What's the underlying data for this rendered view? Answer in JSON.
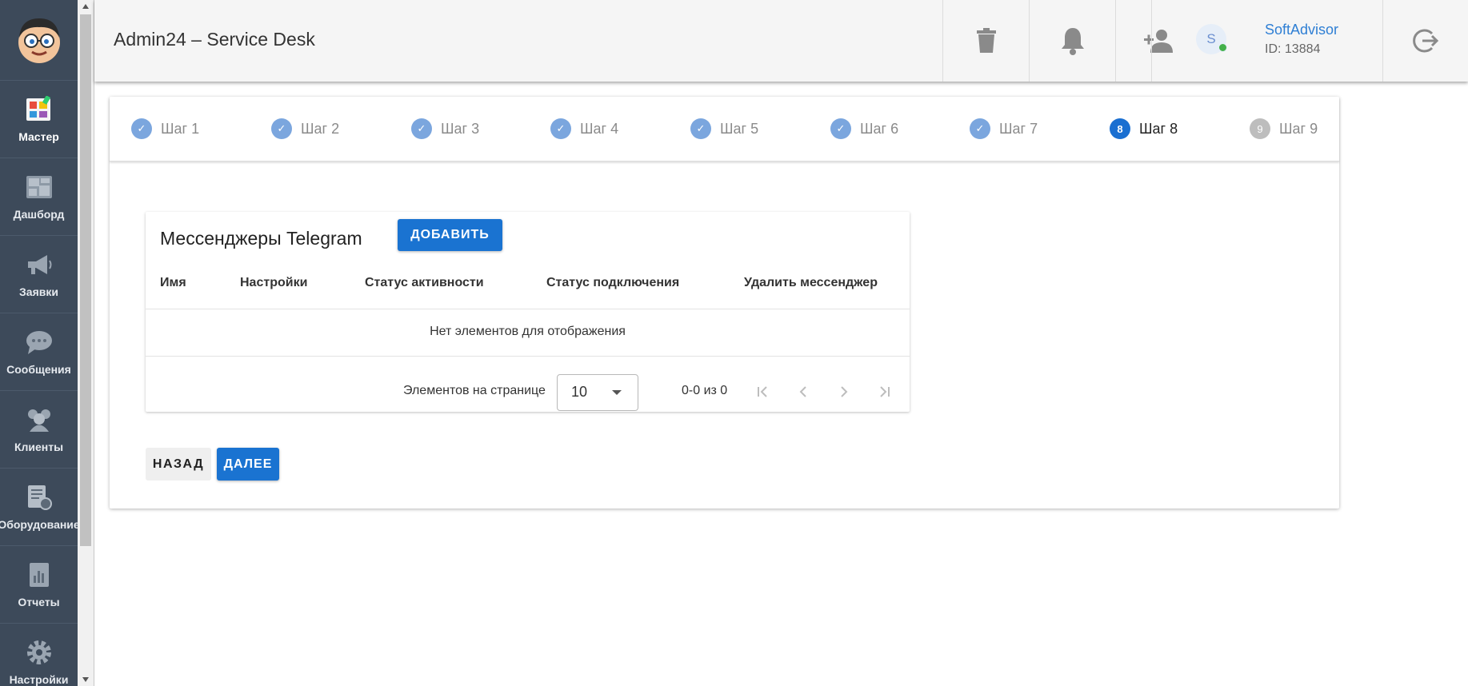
{
  "sidebar": {
    "items": [
      {
        "label": "Мастер",
        "icon": "wizard-icon",
        "active": true
      },
      {
        "label": "Дашборд",
        "icon": "dashboard-icon"
      },
      {
        "label": "Заявки",
        "icon": "megaphone-icon"
      },
      {
        "label": "Сообщения",
        "icon": "chat-icon"
      },
      {
        "label": "Клиенты",
        "icon": "clients-icon"
      },
      {
        "label": "Оборудование",
        "icon": "equipment-icon"
      },
      {
        "label": "Отчеты",
        "icon": "reports-icon"
      },
      {
        "label": "Настройки",
        "icon": "gear-icon"
      }
    ]
  },
  "header": {
    "title": "Admin24 – Service Desk",
    "user": {
      "avatar_letter": "S",
      "name": "SoftAdvisor",
      "id": "ID: 13884"
    },
    "icons": [
      "trash-icon",
      "bell-icon",
      "add-user-icon",
      "logout-icon"
    ]
  },
  "stepper": {
    "steps": [
      {
        "label": "Шаг 1",
        "state": "done"
      },
      {
        "label": "Шаг 2",
        "state": "done"
      },
      {
        "label": "Шаг 3",
        "state": "done"
      },
      {
        "label": "Шаг 4",
        "state": "done"
      },
      {
        "label": "Шаг 5",
        "state": "done"
      },
      {
        "label": "Шаг 6",
        "state": "done"
      },
      {
        "label": "Шаг 7",
        "state": "done"
      },
      {
        "label": "Шаг 8",
        "state": "current",
        "number": "8"
      },
      {
        "label": "Шаг 9",
        "state": "future",
        "number": "9"
      }
    ]
  },
  "messengers": {
    "title": "Мессенджеры Telegram",
    "add_label": "ДОБАВИТЬ",
    "columns": [
      "Имя",
      "Настройки",
      "Статус активности",
      "Статус подключения",
      "Удалить мессенджер"
    ],
    "empty_text": "Нет элементов для отображения",
    "pager": {
      "per_page_label": "Элементов на странице",
      "per_page_value": "10",
      "range": "0-0 из 0"
    }
  },
  "nav_buttons": {
    "back": "НАЗАД",
    "next": "ДАЛЕЕ"
  },
  "colors": {
    "primary": "#1a73d1",
    "sidebar": "#3d4a5a",
    "step_done": "#7ba6de",
    "online": "#43b04a"
  }
}
